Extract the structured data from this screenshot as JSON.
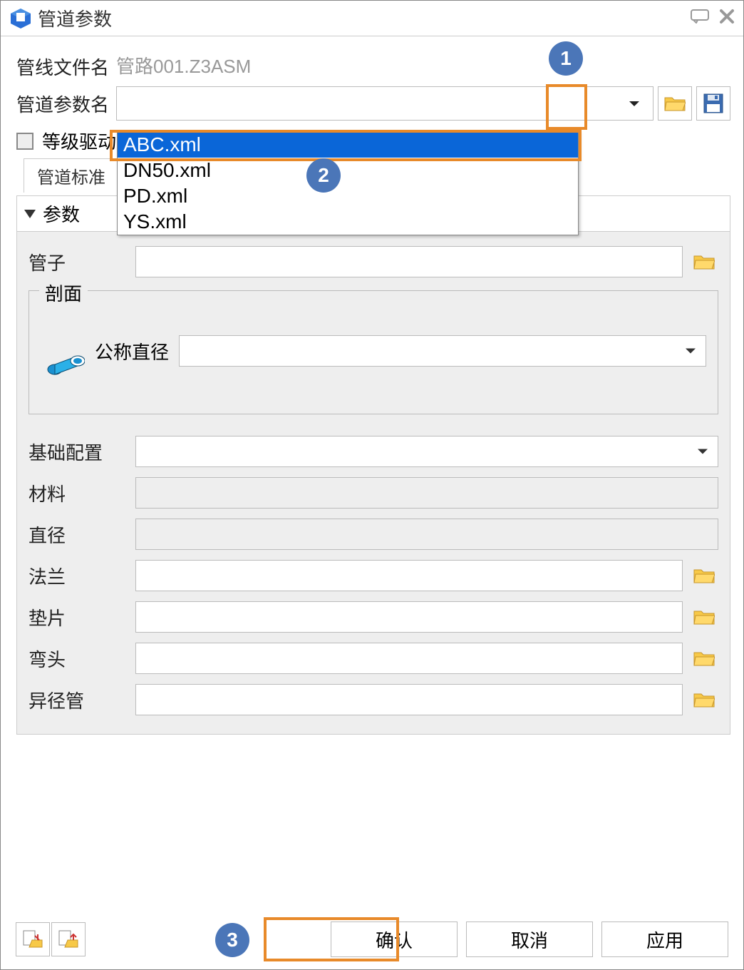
{
  "title": "管道参数",
  "fields": {
    "pipeline_file_label": "管线文件名",
    "pipeline_file_value": "管路001.Z3ASM",
    "pipeline_param_label": "管道参数名",
    "grade_drive_label": "等级驱动"
  },
  "dropdown": {
    "options": [
      "ABC.xml",
      "DN50.xml",
      "PD.xml",
      "YS.xml"
    ],
    "selected": "ABC.xml"
  },
  "tabs": {
    "standard": "管道标准"
  },
  "panel": {
    "header": "参数",
    "pipe_label": "管子",
    "section_legend": "剖面",
    "nominal_diameter_label": "公称直径",
    "base_config_label": "基础配置",
    "material_label": "材料",
    "diameter_label": "直径",
    "flange_label": "法兰",
    "gasket_label": "垫片",
    "elbow_label": "弯头",
    "reducer_label": "异径管"
  },
  "buttons": {
    "confirm": "确认",
    "cancel": "取消",
    "apply": "应用"
  },
  "callouts": {
    "c1": "1",
    "c2": "2",
    "c3": "3"
  }
}
